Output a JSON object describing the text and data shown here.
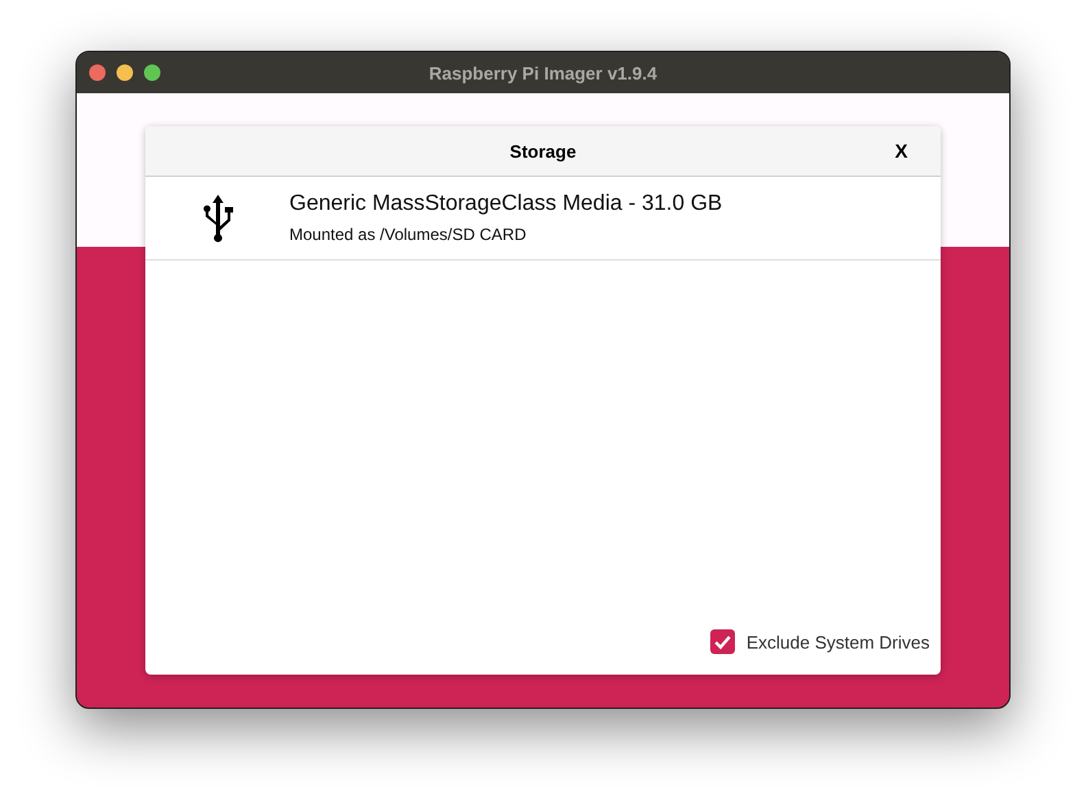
{
  "window": {
    "title": "Raspberry Pi Imager v1.9.4"
  },
  "dialog": {
    "title": "Storage",
    "close": "X",
    "devices": [
      {
        "kind": "usb",
        "name": "Generic MassStorageClass Media - 31.0 GB",
        "detail": "Mounted as /Volumes/SD CARD"
      }
    ],
    "exclude_system_drives": {
      "label": "Exclude System Drives",
      "checked": true
    }
  }
}
